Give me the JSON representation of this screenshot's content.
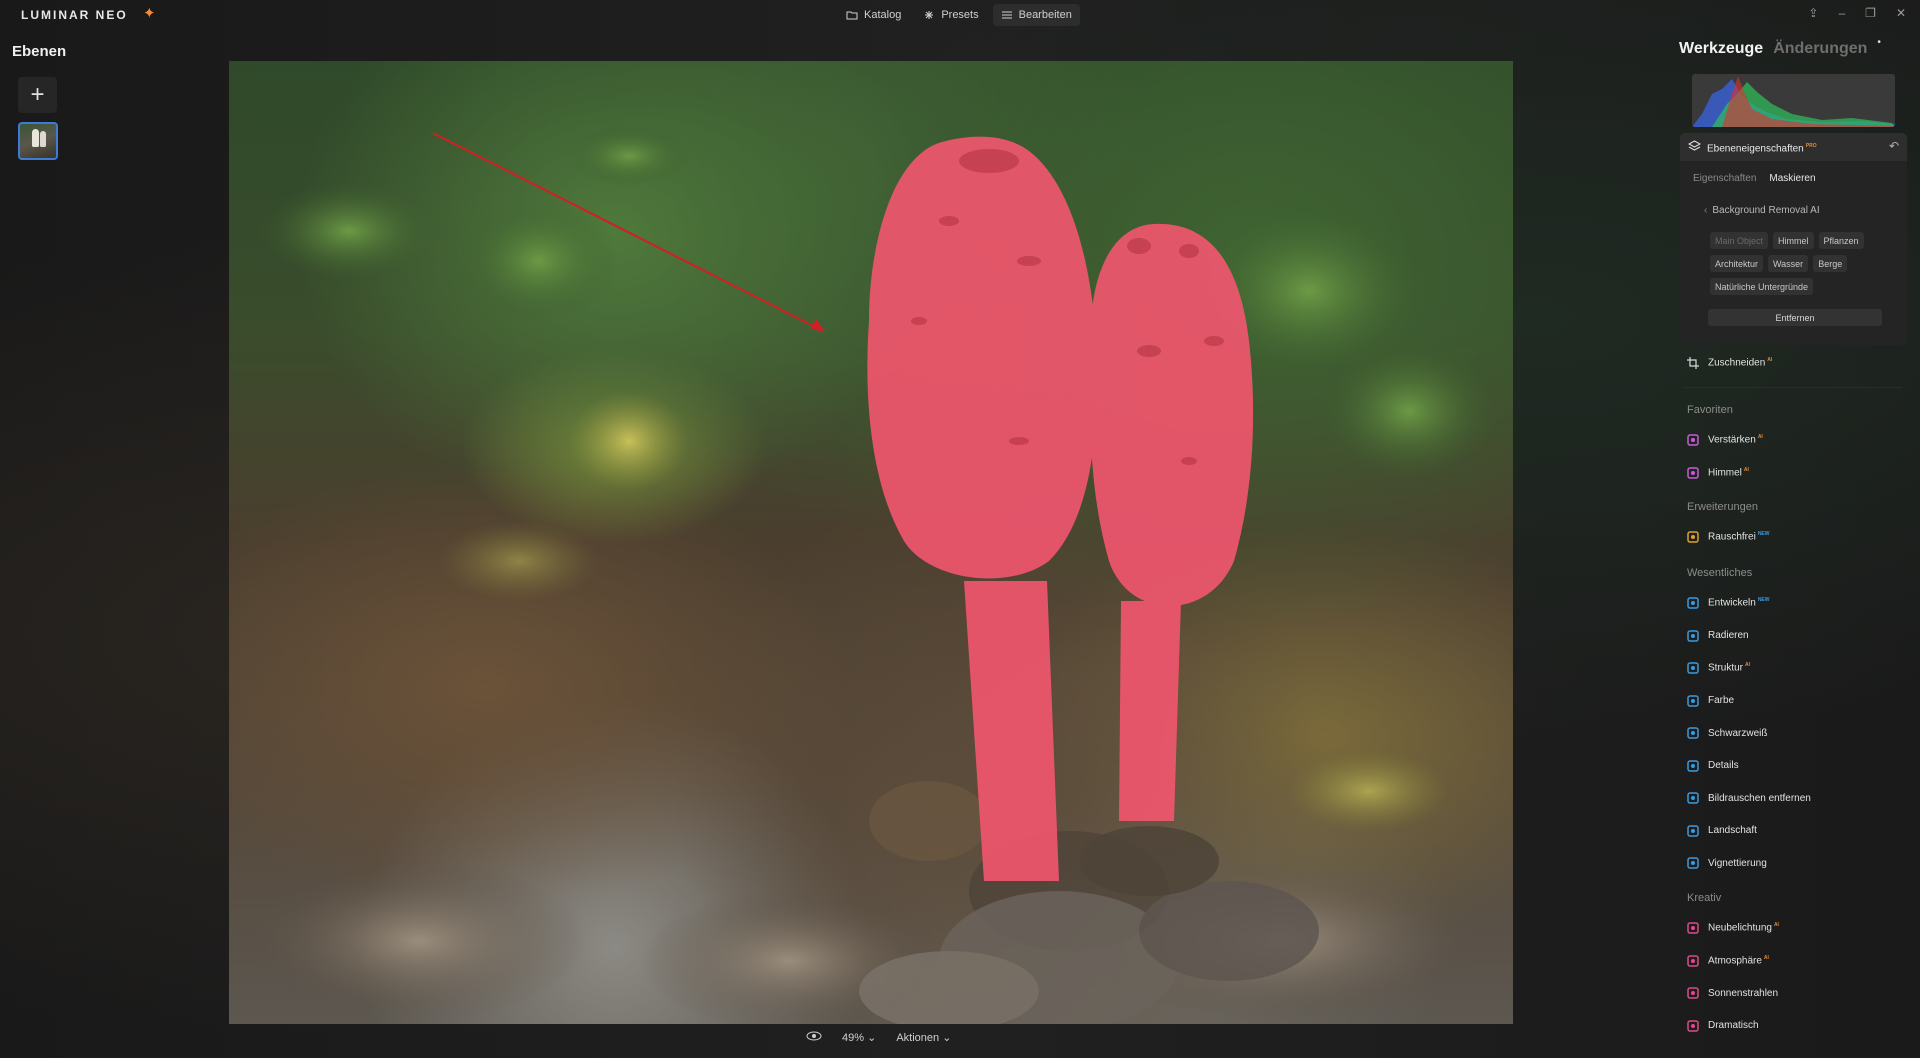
{
  "app": {
    "logo": "LUMINAR NEO"
  },
  "nav": {
    "katalog": "Katalog",
    "presets": "Presets",
    "bearbeiten": "Bearbeiten"
  },
  "left_panel": {
    "title": "Ebenen",
    "add": "+"
  },
  "bottom": {
    "zoom": "49%",
    "actions": "Aktionen"
  },
  "right_panel": {
    "tab_tools": "Werkzeuge",
    "tab_changes": "Änderungen",
    "layer_props": {
      "title": "Ebeneneigenschaften",
      "badge": "PRO",
      "subtabs": [
        "Eigenschaften",
        "Maskieren"
      ],
      "bg_removal": "Background Removal AI",
      "chips": [
        "Main Object",
        "Himmel",
        "Pflanzen",
        "Architektur",
        "Wasser",
        "Berge",
        "Natürliche Untergründe"
      ],
      "remove": "Entfernen"
    },
    "crop": {
      "label": "Zuschneiden",
      "badge": "AI"
    },
    "sections": {
      "favoriten": "Favoriten",
      "erweiterungen": "Erweiterungen",
      "wesentliches": "Wesentliches",
      "kreativ": "Kreativ"
    },
    "favoriten": [
      {
        "label": "Verstärken",
        "badge": "AI",
        "icon": "sparkle-icon",
        "color": "#c95bd8"
      },
      {
        "label": "Himmel",
        "badge": "AI",
        "icon": "cloud-icon",
        "color": "#c95bd8"
      }
    ],
    "erweiterungen": [
      {
        "label": "Rauschfrei",
        "badge": "NEW",
        "icon": "noise-icon",
        "color": "#e0a030"
      }
    ],
    "wesentliches": [
      {
        "label": "Entwickeln",
        "badge": "NEW",
        "icon": "sun-icon",
        "color": "#3a9ae0"
      },
      {
        "label": "Radieren",
        "badge": "",
        "icon": "eraser-icon",
        "color": "#3a9ae0"
      },
      {
        "label": "Struktur",
        "badge": "AI",
        "icon": "structure-icon",
        "color": "#3a9ae0"
      },
      {
        "label": "Farbe",
        "badge": "",
        "icon": "palette-icon",
        "color": "#3a9ae0"
      },
      {
        "label": "Schwarzweiß",
        "badge": "",
        "icon": "bw-icon",
        "color": "#3a9ae0"
      },
      {
        "label": "Details",
        "badge": "",
        "icon": "details-icon",
        "color": "#3a9ae0"
      },
      {
        "label": "Bildrauschen entfernen",
        "badge": "",
        "icon": "denoise-icon",
        "color": "#3a9ae0"
      },
      {
        "label": "Landschaft",
        "badge": "",
        "icon": "landscape-icon",
        "color": "#3a9ae0"
      },
      {
        "label": "Vignettierung",
        "badge": "",
        "icon": "vignette-icon",
        "color": "#3a9ae0"
      }
    ],
    "kreativ": [
      {
        "label": "Neubelichtung",
        "badge": "AI",
        "icon": "relight-icon",
        "color": "#e04a8c"
      },
      {
        "label": "Atmosphäre",
        "badge": "AI",
        "icon": "atmosphere-icon",
        "color": "#e04a8c"
      },
      {
        "label": "Sonnenstrahlen",
        "badge": "",
        "icon": "sunrays-icon",
        "color": "#e04a8c"
      },
      {
        "label": "Dramatisch",
        "badge": "",
        "icon": "dramatic-icon",
        "color": "#e04a8c"
      }
    ]
  },
  "colors": {
    "accent": "#3d7bd6",
    "mask": "#f0566e"
  }
}
